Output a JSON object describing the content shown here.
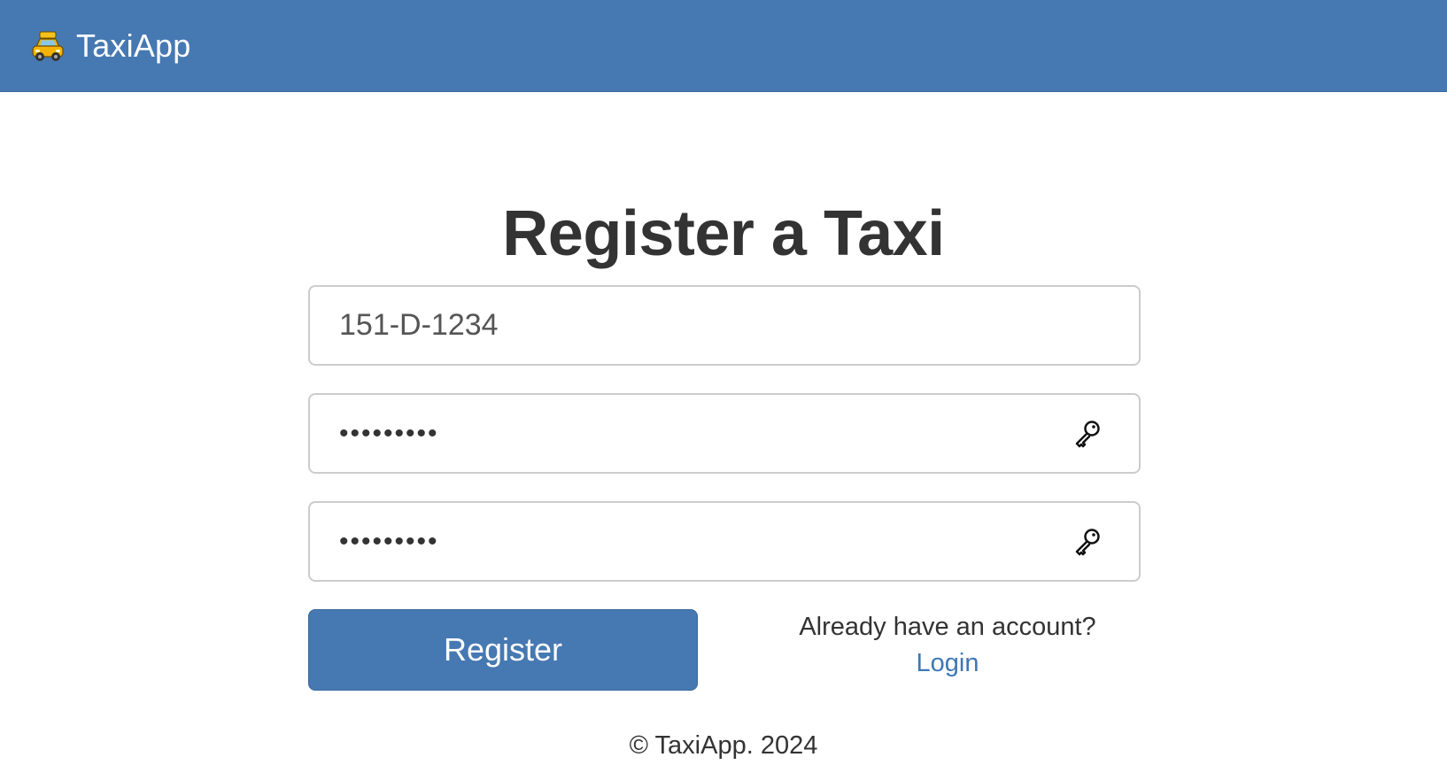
{
  "navbar": {
    "brand_text": "TaxiApp",
    "brand_icon": "taxi-icon",
    "background_color": "#4679b2"
  },
  "form": {
    "title": "Register a Taxi",
    "username_value": "151-D-1234",
    "password_value": "password1",
    "confirm_password_value": "password1",
    "password_icon": "key-icon",
    "register_label": "Register",
    "account_prompt": "Already have an account?",
    "login_label": "Login"
  },
  "footer": {
    "text": "© TaxiApp. 2024"
  },
  "colors": {
    "accent": "#4679b2",
    "link": "#3d78b4",
    "text": "#333333",
    "input_border": "#cccccc"
  }
}
